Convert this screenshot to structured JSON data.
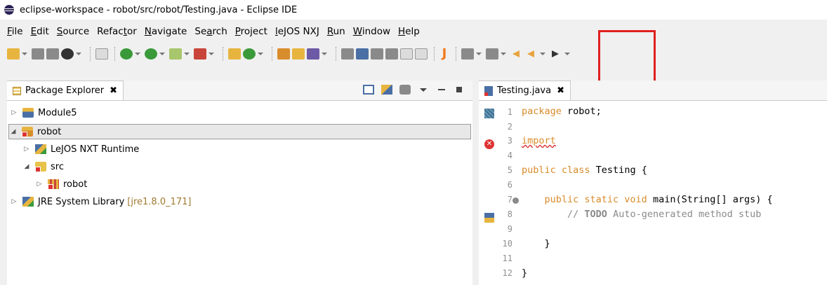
{
  "window": {
    "title": "eclipse-workspace - robot/src/robot/Testing.java - Eclipse IDE"
  },
  "menubar": [
    {
      "mnemonic": "F",
      "rest": "ile"
    },
    {
      "mnemonic": "E",
      "rest": "dit"
    },
    {
      "mnemonic": "S",
      "rest": "ource"
    },
    {
      "pre": "Refac",
      "mnemonic": "t",
      "rest": "or"
    },
    {
      "mnemonic": "N",
      "rest": "avigate"
    },
    {
      "pre": "Se",
      "mnemonic": "a",
      "rest": "rch"
    },
    {
      "mnemonic": "P",
      "rest": "roject"
    },
    {
      "mnemonic": "l",
      "rest": "eJOS NXJ"
    },
    {
      "mnemonic": "R",
      "rest": "un"
    },
    {
      "mnemonic": "W",
      "rest": "indow"
    },
    {
      "mnemonic": "H",
      "rest": "elp"
    }
  ],
  "toolbar": {
    "highlighted_tool": "lejos-j-icon",
    "highlight_color": "#e02020"
  },
  "package_explorer": {
    "tab_label": "Package Explorer",
    "tree": [
      {
        "label": "Module5",
        "icon": "project-icon",
        "expanded": false
      },
      {
        "label": "robot",
        "icon": "project-error-icon",
        "expanded": true,
        "selected": true
      },
      {
        "label": "LeJOS NXT Runtime",
        "icon": "library-icon",
        "expanded": false
      },
      {
        "label": "src",
        "icon": "source-folder-error-icon",
        "expanded": true
      },
      {
        "label": "robot",
        "icon": "package-error-icon",
        "expanded": false
      },
      {
        "label": "JRE System Library",
        "version": "[jre1.8.0_171]",
        "icon": "library-icon",
        "expanded": false
      }
    ]
  },
  "editor": {
    "tab_label": "Testing.java",
    "lines": [
      "1",
      "2",
      "3",
      "4",
      "5",
      "6",
      "7",
      "8",
      "9",
      "10",
      "11",
      "12"
    ],
    "code": {
      "l1_kw": "package",
      "l1_rest": " robot;",
      "l3_kw": "import",
      "l5_kw": "public class",
      "l5_rest": " Testing {",
      "l7_kw": "public static void",
      "l7_rest": " main(String[] args) {",
      "l8_comment": "// ",
      "l8_todo": "TODO",
      "l8_rest": " Auto-generated method stub",
      "l10": "}",
      "l12": "}"
    },
    "colors": {
      "keyword": "#d98b2a",
      "comment": "#8a8a8a",
      "error": "#dd3333"
    }
  }
}
